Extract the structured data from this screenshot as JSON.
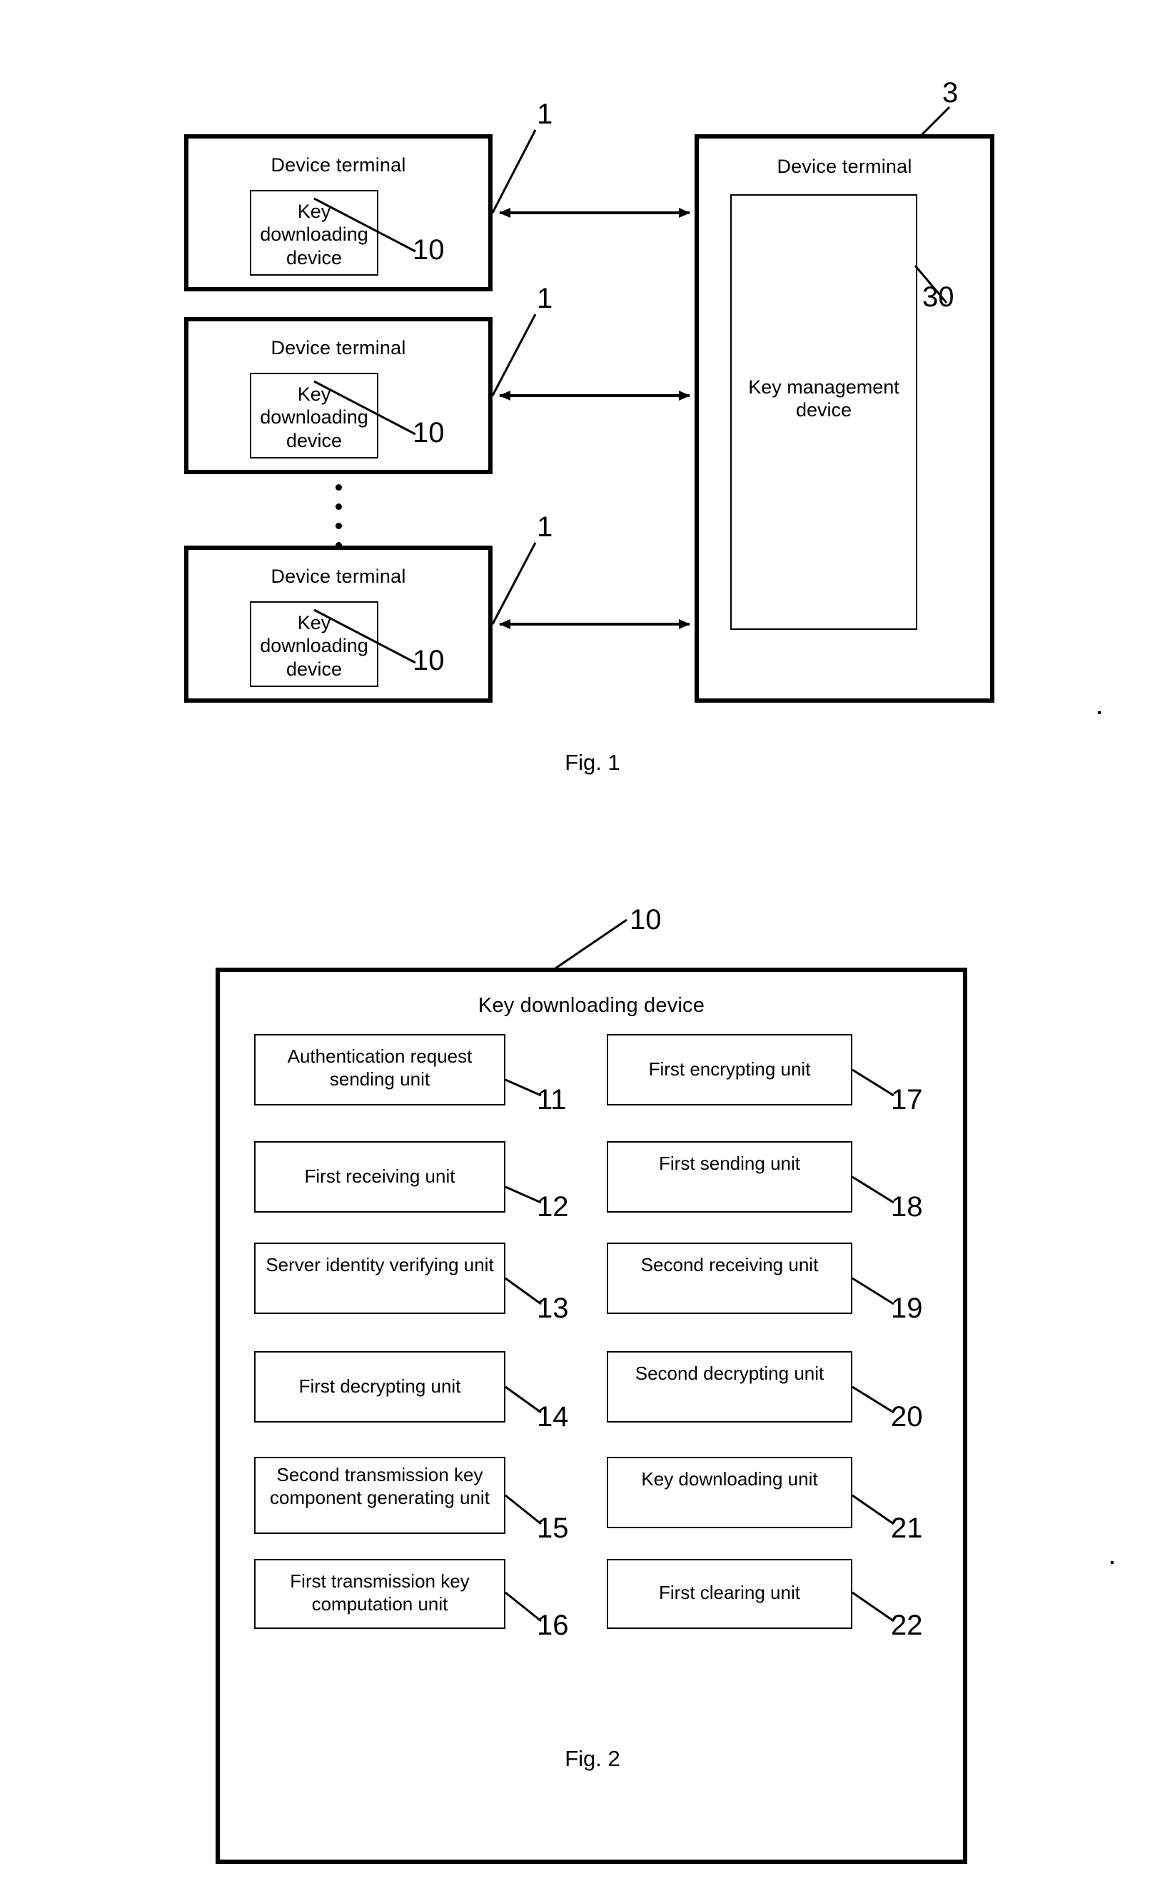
{
  "figure1": {
    "caption": "Fig. 1",
    "terminals": [
      {
        "title": "Device terminal",
        "ref": "1",
        "inner": {
          "title": "Key downloading device",
          "ref": "10"
        }
      },
      {
        "title": "Device terminal",
        "ref": "1",
        "inner": {
          "title": "Key downloading device",
          "ref": "10"
        }
      },
      {
        "title": "Device terminal",
        "ref": "1",
        "inner": {
          "title": "Key downloading device",
          "ref": "10"
        }
      }
    ],
    "server": {
      "title": "Device terminal",
      "ref": "3",
      "inner": {
        "title": "Key management device",
        "ref": "30"
      }
    },
    "connector_label": "bidirectional-arrow"
  },
  "figure2": {
    "caption": "Fig. 2",
    "title": "Key downloading device",
    "ref": "10",
    "units_left": [
      {
        "label": "Authentication request sending unit",
        "ref": "11"
      },
      {
        "label": "First receiving unit",
        "ref": "12"
      },
      {
        "label": "Server identity verifying unit",
        "ref": "13"
      },
      {
        "label": "First decrypting unit",
        "ref": "14"
      },
      {
        "label": "Second transmission key component generating unit",
        "ref": "15"
      },
      {
        "label": "First transmission key computation unit",
        "ref": "16"
      }
    ],
    "units_right": [
      {
        "label": "First encrypting unit",
        "ref": "17"
      },
      {
        "label": "First sending unit",
        "ref": "18"
      },
      {
        "label": "Second receiving unit",
        "ref": "19"
      },
      {
        "label": "Second decrypting unit",
        "ref": "20"
      },
      {
        "label": "Key downloading unit",
        "ref": "21"
      },
      {
        "label": "First clearing unit",
        "ref": "22"
      }
    ]
  },
  "colors": {
    "ink": "#000000",
    "paper": "#ffffff"
  }
}
